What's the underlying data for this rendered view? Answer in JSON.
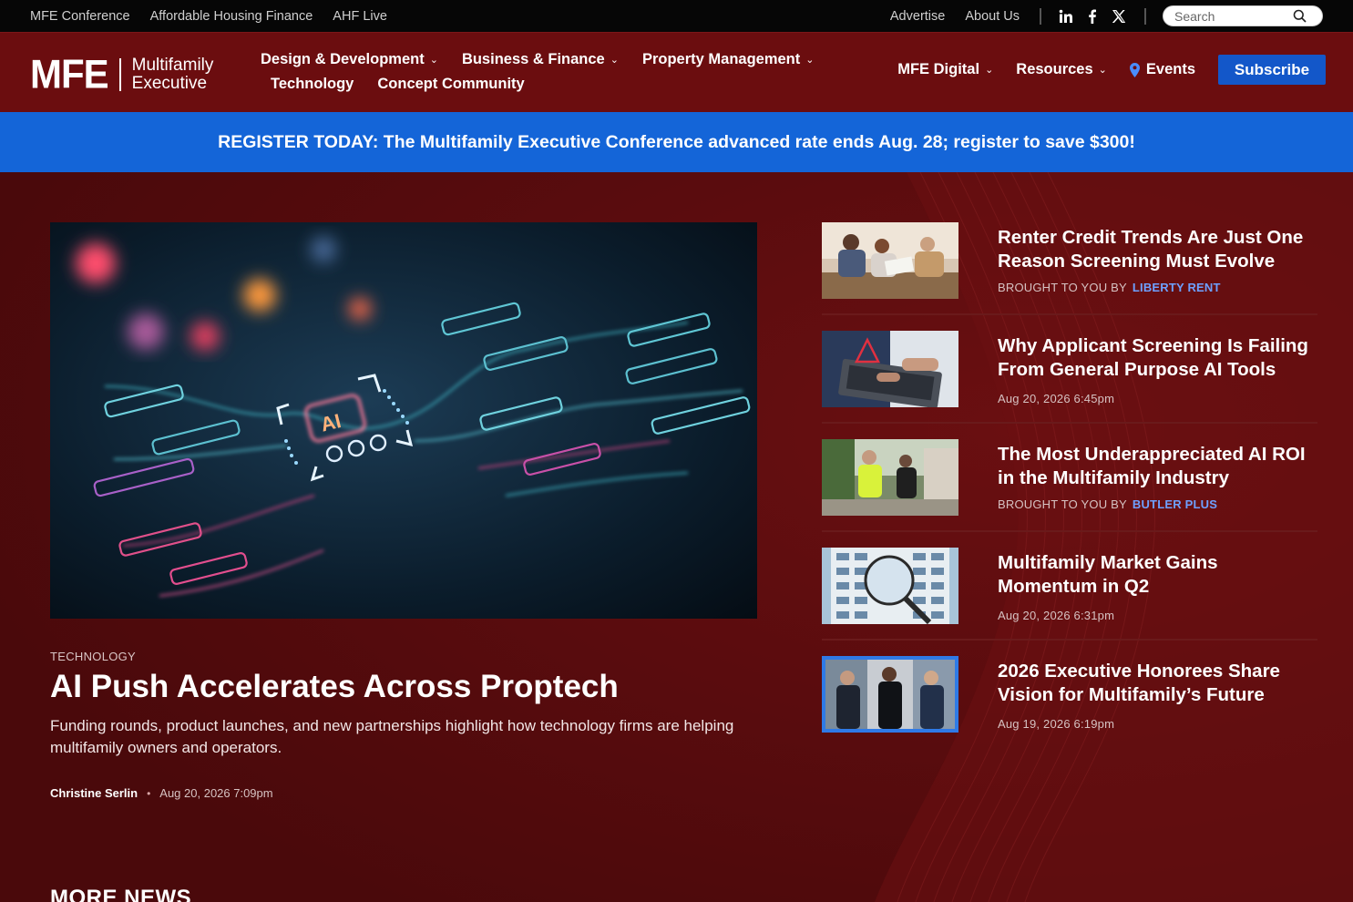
{
  "topbar": {
    "left_links": [
      "MFE Conference",
      "Affordable Housing Finance",
      "AHF Live"
    ],
    "right_links": [
      "Advertise",
      "About Us"
    ],
    "social_icons": [
      "linkedin-icon",
      "facebook-icon",
      "x-icon"
    ],
    "search_placeholder": "Search"
  },
  "header": {
    "logo_mark": "MFE",
    "logo_line1": "Multifamily",
    "logo_line2": "Executive",
    "nav_row1": [
      {
        "label": "Design & Development",
        "dropdown": true
      },
      {
        "label": "Business & Finance",
        "dropdown": true
      },
      {
        "label": "Property Management",
        "dropdown": true
      }
    ],
    "nav_row2": [
      {
        "label": "Technology",
        "dropdown": false
      },
      {
        "label": "Concept Community",
        "dropdown": false
      }
    ],
    "nav_right": [
      {
        "label": "MFE Digital",
        "dropdown": true
      },
      {
        "label": "Resources",
        "dropdown": true
      },
      {
        "label": "Events",
        "icon": "location-pin-icon"
      }
    ],
    "subscribe_label": "Subscribe"
  },
  "banner": {
    "text": "REGISTER TODAY: The Multifamily Executive Conference advanced rate ends Aug. 28; register to save $300!"
  },
  "hero": {
    "kicker": "TECHNOLOGY",
    "title": "AI Push Accelerates Across Proptech",
    "dek": "Funding rounds, product launches, and new partnerships highlight how technology firms are helping multifamily owners and operators.",
    "author": "Christine Serlin",
    "date": "Aug 20, 2026 7:09pm",
    "image_label": "AI"
  },
  "sidebar": {
    "items": [
      {
        "title": "Renter Credit Trends Are Just One Reason Screening Must Evolve",
        "meta_prefix": "BROUGHT TO YOU BY",
        "sponsor": "LIBERTY RENT",
        "date": ""
      },
      {
        "title": "Why Applicant Screening Is Failing From General Purpose AI Tools",
        "meta_prefix": "",
        "sponsor": "",
        "date": "Aug 20, 2026 6:45pm"
      },
      {
        "title": "The Most Underappreciated AI ROI in the Multifamily Industry",
        "meta_prefix": "BROUGHT TO YOU BY",
        "sponsor": "BUTLER PLUS",
        "date": ""
      },
      {
        "title": "Multifamily Market Gains Momentum in Q2",
        "meta_prefix": "",
        "sponsor": "",
        "date": "Aug 20, 2026 6:31pm"
      },
      {
        "title": "2026 Executive Honorees Share Vision for Multifamily’s Future",
        "meta_prefix": "",
        "sponsor": "",
        "date": "Aug 19, 2026 6:19pm"
      }
    ]
  },
  "more_news": {
    "heading": "MORE NEWS"
  },
  "colors": {
    "topbar_bg": "#060606",
    "header_bg": "#6b0d0f",
    "banner_bg": "#1465d8",
    "page_bg": "#4e0a0c",
    "subscribe_bg": "#1357c9",
    "sponsor_link": "#6ea0ff"
  }
}
